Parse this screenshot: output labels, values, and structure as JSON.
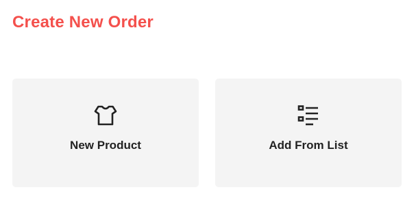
{
  "colors": {
    "accent": "#f4504c",
    "card_background": "#f4f4f4",
    "text_dark": "#222222",
    "icon": "#222222"
  },
  "header": {
    "title": "Create New Order"
  },
  "options": [
    {
      "label": "New Product",
      "icon": "tshirt-icon"
    },
    {
      "label": "Add From List",
      "icon": "list-icon"
    }
  ]
}
